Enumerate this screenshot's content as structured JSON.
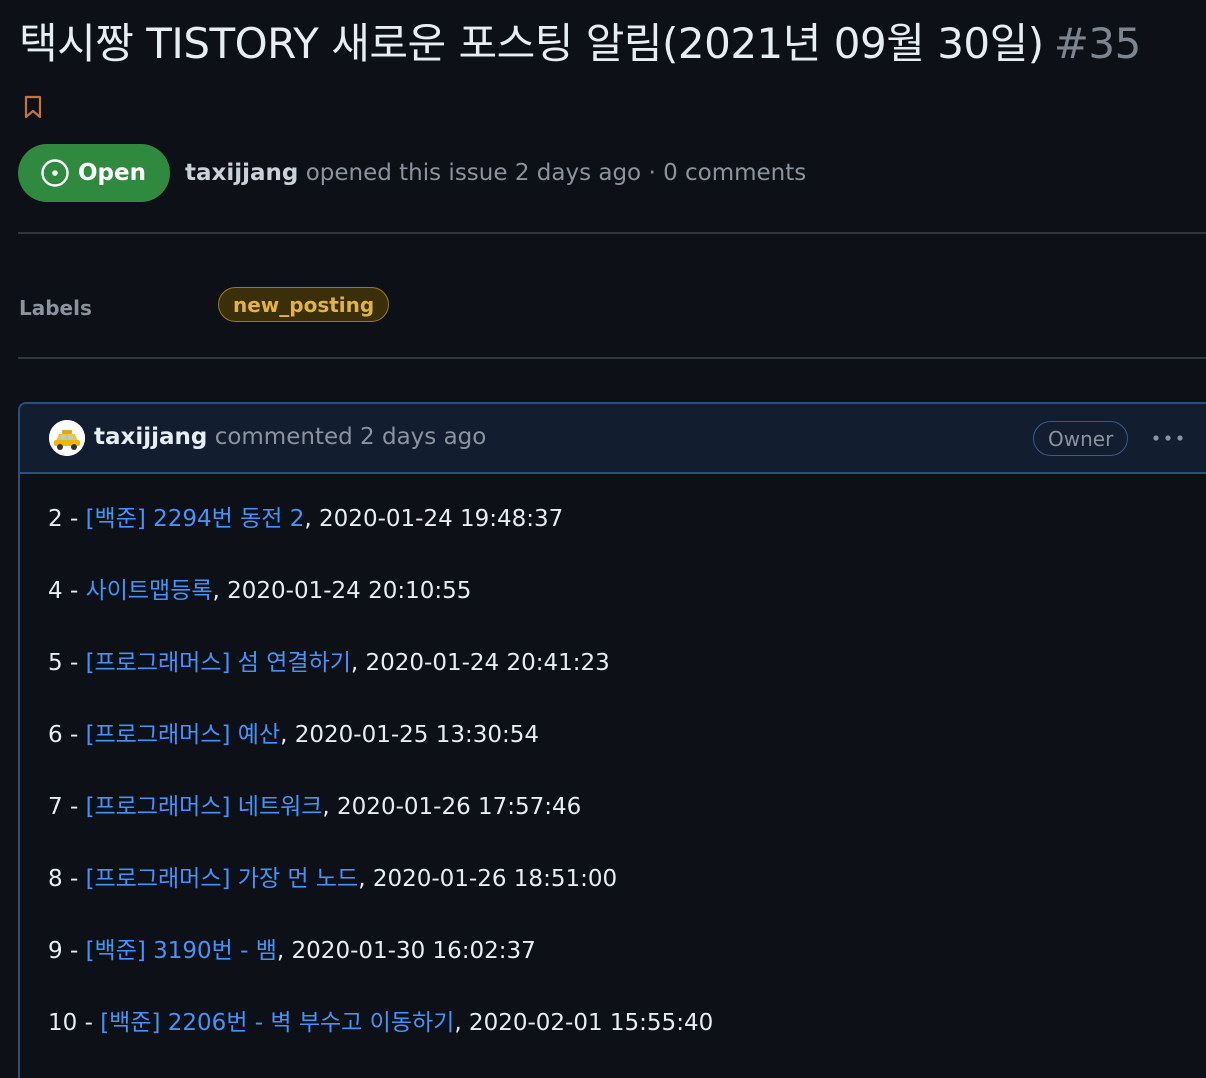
{
  "issue": {
    "title": "택시짱 TISTORY 새로운 포스팅 알림(2021년 09월 30일)",
    "number": "#35",
    "state": "Open",
    "author": "taxijjang",
    "meta_text": "opened this issue 2 days ago · 0 comments"
  },
  "sidebar": {
    "labels_heading": "Labels",
    "label": "new_posting"
  },
  "comment": {
    "author": "taxijjang",
    "time_text": "commented 2 days ago",
    "role_badge": "Owner",
    "posts": [
      {
        "prefix": "2 - ",
        "title": "[백준] 2294번 동전 2",
        "date": ", 2020-01-24 19:48:37"
      },
      {
        "prefix": "4 - ",
        "title": "사이트맵등록",
        "date": ", 2020-01-24 20:10:55"
      },
      {
        "prefix": "5 - ",
        "title": "[프로그래머스] 섬 연결하기",
        "date": ", 2020-01-24 20:41:23"
      },
      {
        "prefix": "6 - ",
        "title": "[프로그래머스] 예산",
        "date": ", 2020-01-25 13:30:54"
      },
      {
        "prefix": "7 - ",
        "title": "[프로그래머스] 네트워크",
        "date": ", 2020-01-26 17:57:46"
      },
      {
        "prefix": "8 - ",
        "title": "[프로그래머스] 가장 먼 노드",
        "date": ", 2020-01-26 18:51:00"
      },
      {
        "prefix": "9 - ",
        "title": "[백준] 3190번 - 뱀",
        "date": ", 2020-01-30 16:02:37"
      },
      {
        "prefix": "10 - ",
        "title": "[백준] 2206번 - 벽 부수고 이동하기",
        "date": ", 2020-02-01 15:55:40"
      }
    ]
  },
  "colors": {
    "background": "#0d1117",
    "open_badge": "#2f8a3f",
    "link": "#4493f8",
    "label_text": "#e3b341",
    "bookmark": "#c0763a"
  },
  "icons": {
    "bookmark": "bookmark-icon",
    "open_state": "issue-opened-icon",
    "avatar": "taxi-avatar",
    "more": "kebab-horizontal-icon"
  }
}
